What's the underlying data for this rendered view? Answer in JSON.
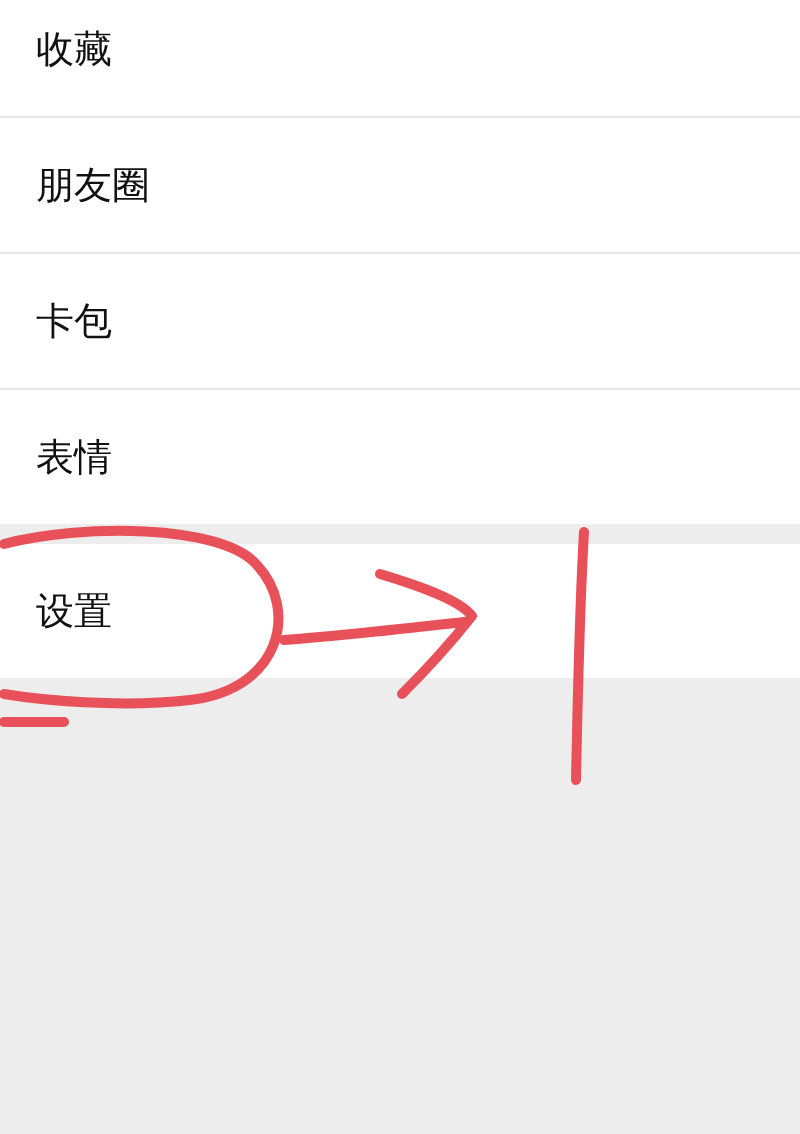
{
  "menu_groups": [
    {
      "items": [
        {
          "label": "收藏"
        },
        {
          "label": "朋友圈"
        },
        {
          "label": "卡包"
        },
        {
          "label": "表情"
        }
      ]
    },
    {
      "items": [
        {
          "label": "设置"
        }
      ]
    }
  ]
}
